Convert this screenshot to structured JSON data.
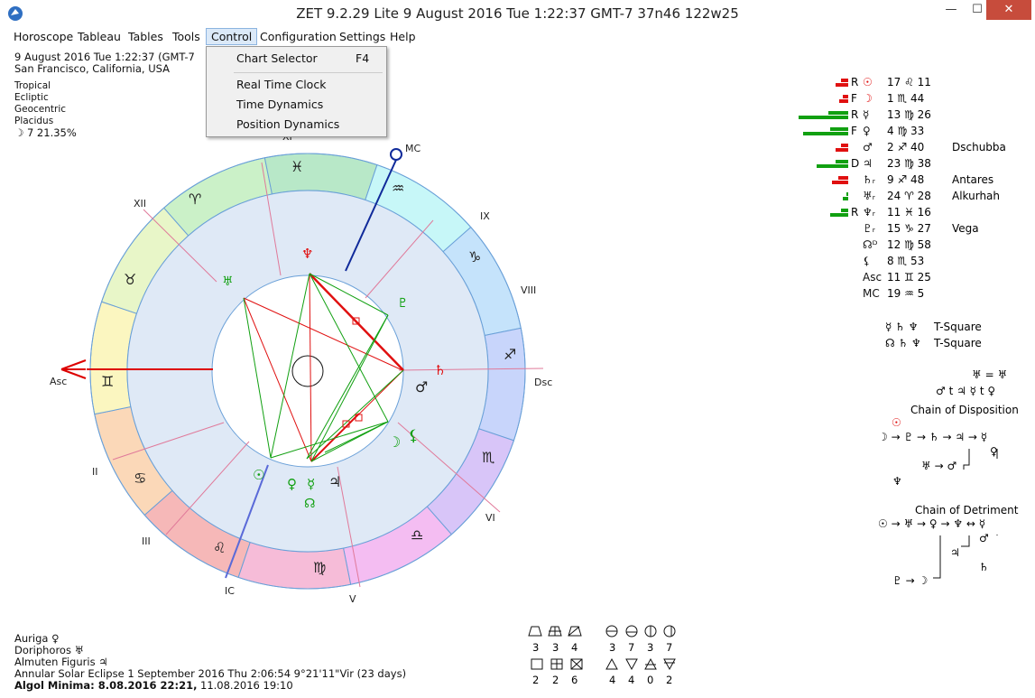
{
  "window": {
    "title": "ZET 9.2.29 Lite     9 August 2016   Tue    1:22:37 GMT-7 37n46  122w25",
    "min_label": "—",
    "max_label": "☐",
    "close_label": "✕"
  },
  "menu": {
    "items": [
      "Horoscope",
      "Tableau",
      "Tables",
      "Tools",
      "Control",
      "Configuration",
      "Settings",
      "Help"
    ],
    "active": "Control"
  },
  "dropdown": {
    "items": [
      {
        "label": "Chart Selector",
        "shortcut": "F4"
      },
      {
        "label": "Real Time Clock",
        "shortcut": ""
      },
      {
        "label": "Time Dynamics",
        "shortcut": ""
      },
      {
        "label": "Position Dynamics",
        "shortcut": ""
      }
    ]
  },
  "header_info": {
    "date_line": "9 August 2016   Tue    1:22:37 (GMT-7",
    "place": "San Francisco, California, USA",
    "zodiac": "Tropical",
    "plane": "Ecliptic",
    "center": "Geocentric",
    "houses": "Placidus",
    "moon_line": "☽   7 21.35%"
  },
  "chart_labels": {
    "asc": "Asc",
    "dsc": "Dsc",
    "mc": "MC",
    "ic": "IC",
    "houses": [
      "II",
      "III",
      "V",
      "VI",
      "VIII",
      "IX",
      "XI",
      "XII"
    ]
  },
  "planets": [
    {
      "flag": "R",
      "symbol": "☉",
      "position": "17 ♌ 11",
      "star": "",
      "bar_green": 0,
      "bar_red": 14
    },
    {
      "flag": "F",
      "symbol": "☽",
      "position": " 1 ♏ 44",
      "star": "",
      "bar_green": 0,
      "bar_red": 10
    },
    {
      "flag": "R",
      "symbol": "☿",
      "position": "13 ♍ 26",
      "star": "",
      "bar_green": 55,
      "bar_red": 0
    },
    {
      "flag": "F",
      "symbol": "♀",
      "position": " 4 ♍ 33",
      "star": "",
      "bar_green": 50,
      "bar_red": 0
    },
    {
      "flag": "",
      "symbol": "♂",
      "position": " 2 ♐ 40",
      "star": "Dschubba",
      "bar_green": 0,
      "bar_red": 14
    },
    {
      "flag": "D",
      "symbol": "♃",
      "position": "23 ♍ 38",
      "star": "",
      "bar_green": 35,
      "bar_red": 0
    },
    {
      "flag": "",
      "symbol": "♄ᵣ",
      "position": " 9 ♐ 48",
      "star": "Antares",
      "bar_green": 0,
      "bar_red": 18
    },
    {
      "flag": "",
      "symbol": "♅ᵣ",
      "position": "24 ♈ 28",
      "star": "Alkurhah",
      "bar_green": 6,
      "bar_red": 0
    },
    {
      "flag": "R",
      "symbol": "♆ᵣ",
      "position": "11 ♓ 16",
      "star": "",
      "bar_green": 20,
      "bar_red": 0
    },
    {
      "flag": "",
      "symbol": "♇ᵣ",
      "position": "15 ♑ 27",
      "star": "Vega",
      "bar_green": 0,
      "bar_red": 0
    },
    {
      "flag": "",
      "symbol": "☊ᴰ",
      "position": "12 ♍ 58",
      "star": "",
      "bar_green": 0,
      "bar_red": 0
    },
    {
      "flag": "",
      "symbol": "⚸",
      "position": " 8 ♏ 53",
      "star": "",
      "bar_green": 0,
      "bar_red": 0
    },
    {
      "flag": "",
      "symbol": "Asc",
      "position": "11 ♊ 25",
      "star": "",
      "bar_green": 0,
      "bar_red": 0
    },
    {
      "flag": "",
      "symbol": "MC",
      "position": "19 ♒  5",
      "star": "",
      "bar_green": 0,
      "bar_red": 0
    }
  ],
  "aspects_config": {
    "t_square_1": {
      "planets": "☿ ♄ ♆",
      "label": "T-Square"
    },
    "t_square_2": {
      "planets": "☊ ♄ ♆",
      "label": "T-Square"
    },
    "mutual_1": "♅ = ♅",
    "mutual_2": "♂ t ♃   ☿ t ♀"
  },
  "chains": {
    "disposition_title": "Chain of Disposition",
    "disposition_top": "☉",
    "disposition_line1": "☽ → ♇ → ♄ → ♃ → ☿",
    "disposition_line2": "♀",
    "disposition_line3": "♅ → ♂",
    "disposition_line4": "♆",
    "detriment_title": "Chain of Detriment",
    "detriment_line1": "☉ → ♅ → ♀ → ♆ ↔ ☿",
    "detriment_line2": "♃",
    "detriment_line3": "♂",
    "detriment_line4": "♄",
    "detriment_line5": "♇ → ☽"
  },
  "footer": {
    "auriga": "Auriga  ♀",
    "doriphoros": "Doriphoros  ♅",
    "almuten": "Almuten Figuris  ♃",
    "eclipse": "Annular Solar Eclipse 1 September 2016 Thu  2:06:54  9°21'11\"Vir (23 days)",
    "algol_label": "Algol Minima: 8.08.2016 22:21,",
    "algol_second": "11.08.2016 19:10"
  },
  "element_table": {
    "row1_values": [
      "3",
      "3",
      "4"
    ],
    "row2_values": [
      "2",
      "2",
      "6"
    ],
    "row3_values": [
      "3",
      "7",
      "3",
      "7"
    ],
    "row4_values": [
      "4",
      "4",
      "0",
      "2"
    ]
  },
  "signs": [
    "♈",
    "♉",
    "♊",
    "♋",
    "♌",
    "♍",
    "♎",
    "♏",
    "♐",
    "♑",
    "♒",
    "♓"
  ],
  "colors": {
    "close": "#c74c3c",
    "aspect_red": "#e01010",
    "aspect_green": "#11a011",
    "mc_line": "#102a9a",
    "asc_arrow": "#e01010"
  }
}
